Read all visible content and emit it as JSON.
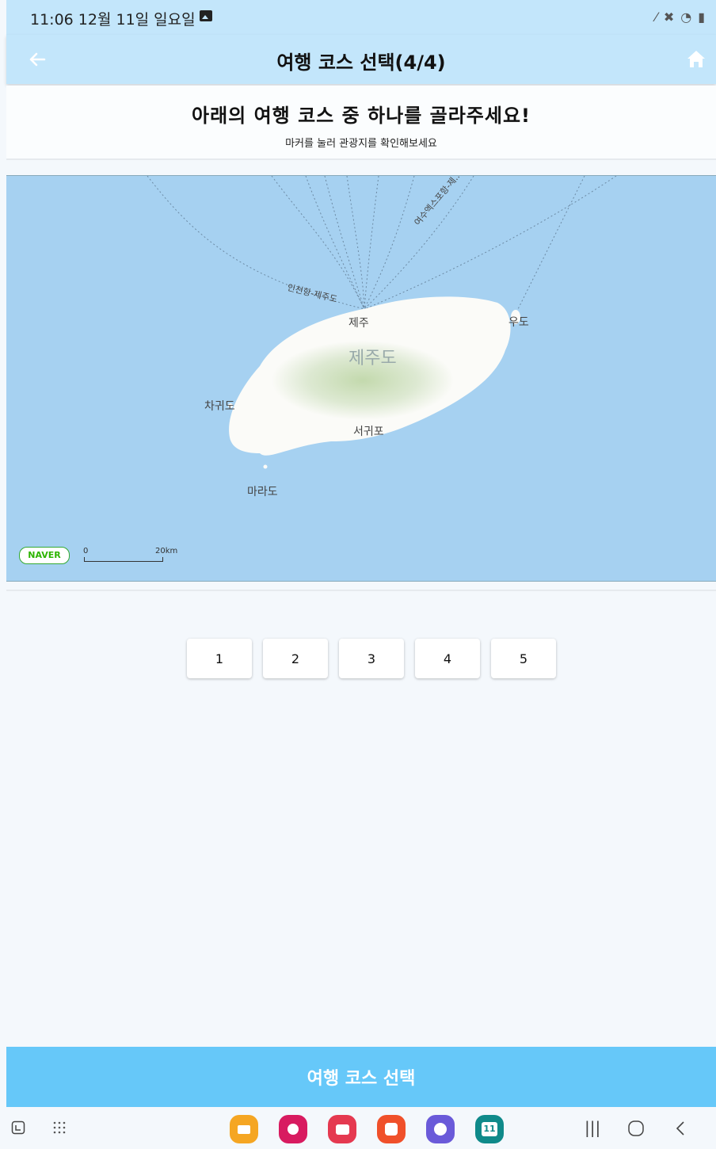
{
  "status_bar": {
    "time": "11:06  12월 11일 일요일"
  },
  "app_bar": {
    "title": "여행 코스 선택(4/4)"
  },
  "header": {
    "heading": "아래의 여행 코스 중 하나를 골라주세요!",
    "subheading": "마커를 눌러 관광지를 확인해보세요"
  },
  "map": {
    "labels": {
      "route_incheon": "인천항-제주도",
      "route_yeosu": "여수엑스포항-제...",
      "jeju_city": "제주",
      "udo": "우도",
      "jejudo": "제주도",
      "chagwido": "차귀도",
      "seogwipo": "서귀포",
      "marado": "마라도"
    },
    "logo": "NAVER",
    "scale": {
      "zero": "0",
      "max": "20km"
    },
    "colors": {
      "sea": "#a6d1f1",
      "land": "#fbfbf8",
      "forest": "#c7dcb6"
    }
  },
  "course_buttons": [
    "1",
    "2",
    "3",
    "4",
    "5"
  ],
  "select_button": {
    "label": "여행 코스 선택",
    "color": "#66c8f9"
  },
  "dock_apps": [
    {
      "icon": "folder-app-icon",
      "color": "#f5a623"
    },
    {
      "icon": "flower-app-icon",
      "color": "#d81b60"
    },
    {
      "icon": "camera-app-icon",
      "color": "#e53950"
    },
    {
      "icon": "notes-app-icon",
      "color": "#f0502a"
    },
    {
      "icon": "browser-app-icon",
      "color": "#6a5ad9"
    },
    {
      "icon": "calendar-app-icon",
      "color": "#0f8a8a"
    }
  ],
  "calendar_day": "11"
}
